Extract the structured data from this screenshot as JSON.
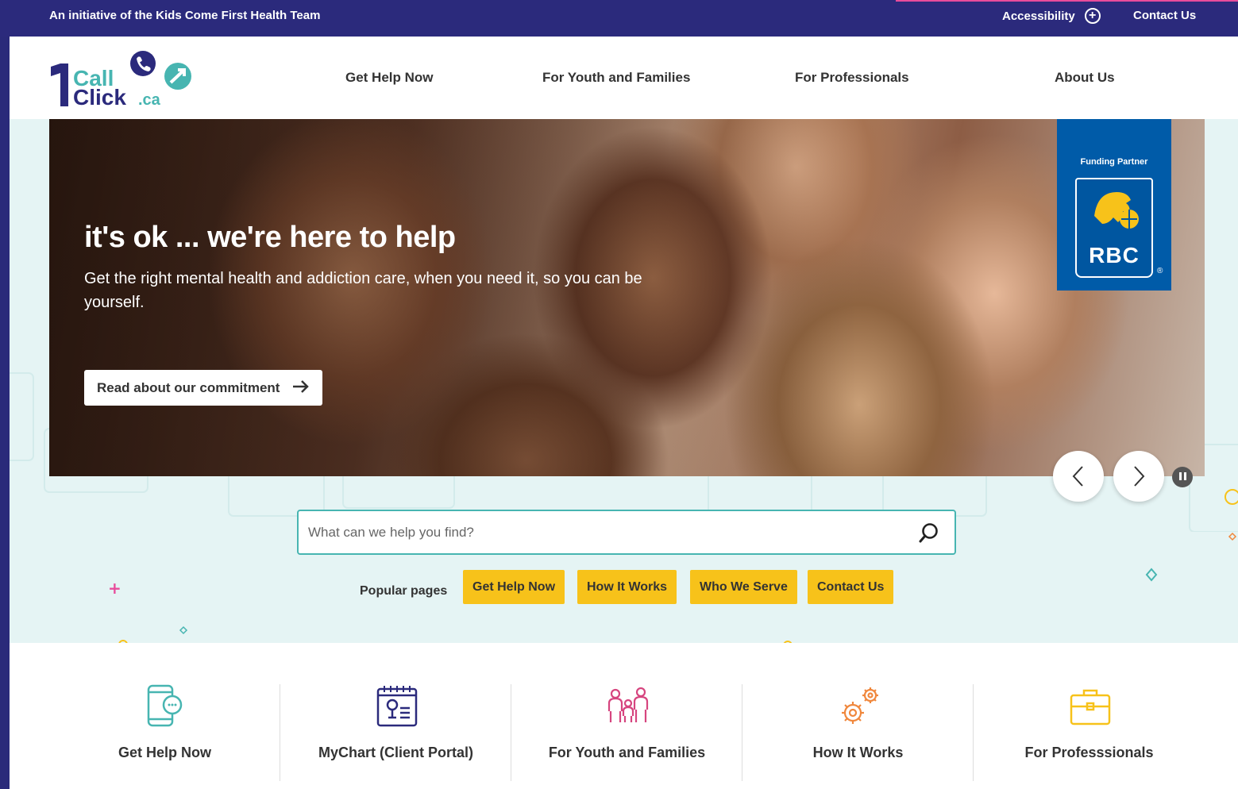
{
  "topbar": {
    "initiative": "An initiative of the Kids Come First Health Team",
    "accessibility": "Accessibility",
    "accessibility_icon": "plus-circle-icon",
    "contact": "Contact Us"
  },
  "logo": {
    "number": "1",
    "call": "Call",
    "click": "Click",
    "domain": ".ca"
  },
  "nav": {
    "items": [
      {
        "label": "Get Help Now"
      },
      {
        "label": "For Youth and Families"
      },
      {
        "label": "For Professionals"
      },
      {
        "label": "About Us"
      }
    ]
  },
  "hero": {
    "title": "it's ok ... we're here to help",
    "subtitle": "Get the right mental health and addiction care, when you need it, so you can be yourself.",
    "cta_label": "Read about our commitment",
    "cta_icon": "arrow-right-icon"
  },
  "sponsor": {
    "caption": "Funding Partner",
    "name": "RBC",
    "reg": "®"
  },
  "carousel": {
    "prev_icon": "chevron-left-icon",
    "next_icon": "chevron-right-icon",
    "pause_icon": "pause-icon"
  },
  "search": {
    "placeholder": "What can we help you find?",
    "icon": "search-icon"
  },
  "popular": {
    "label": "Popular pages",
    "items": [
      {
        "label": "Get Help Now"
      },
      {
        "label": "How It Works"
      },
      {
        "label": "Who We Serve"
      },
      {
        "label": "Contact Us"
      }
    ]
  },
  "cards": [
    {
      "label": "Get Help Now",
      "icon": "phone-chat-icon"
    },
    {
      "label": "MyChart (Client Portal)",
      "icon": "chart-clipboard-icon"
    },
    {
      "label": "For Youth and Families",
      "icon": "family-icon"
    },
    {
      "label": "How It Works",
      "icon": "gears-icon"
    },
    {
      "label": "For Professsionals",
      "icon": "briefcase-icon"
    }
  ],
  "colors": {
    "topbar_bg": "#2b2a7c",
    "band_bg": "#e5f4f4",
    "accent_teal": "#47b5b1",
    "pill_yellow": "#f7c21a",
    "icon_pink": "#d6457f",
    "icon_orange": "#f0873c",
    "icon_navy": "#2b2a7c",
    "rbc_blue": "#005ba8"
  }
}
